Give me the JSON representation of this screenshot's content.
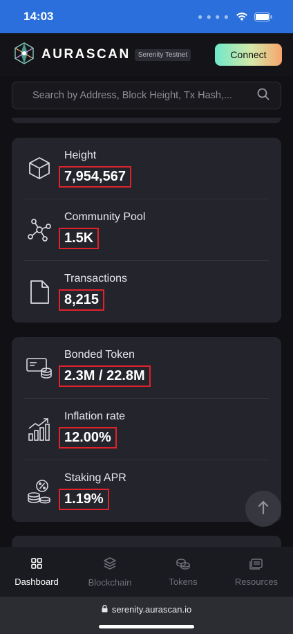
{
  "status_bar": {
    "time": "14:03"
  },
  "header": {
    "logo_text": "AURASCAN",
    "network_badge": "Serenity Testnet",
    "connect_label": "Connect"
  },
  "search": {
    "placeholder": "Search by Address, Block Height, Tx Hash,..."
  },
  "stats_card_1": [
    {
      "label": "Height",
      "value": "7,954,567",
      "icon": "cube-icon"
    },
    {
      "label": "Community Pool",
      "value": "1.5K",
      "icon": "network-nodes-icon"
    },
    {
      "label": "Transactions",
      "value": "8,215",
      "icon": "document-icon"
    }
  ],
  "stats_card_2": [
    {
      "label": "Bonded Token",
      "value": "2.3M / 22.8M",
      "icon": "bonded-token-icon"
    },
    {
      "label": "Inflation rate",
      "value": "12.00%",
      "icon": "growth-chart-icon"
    },
    {
      "label": "Staking APR",
      "value": "1.19%",
      "icon": "coins-percent-icon"
    }
  ],
  "bottom_nav": [
    {
      "label": "Dashboard",
      "icon": "dashboard-grid-icon",
      "active": true
    },
    {
      "label": "Blockchain",
      "icon": "layers-icon",
      "active": false
    },
    {
      "label": "Tokens",
      "icon": "coins-icon",
      "active": false
    },
    {
      "label": "Resources",
      "icon": "resources-icon",
      "active": false
    }
  ],
  "browser": {
    "url": "serenity.aurascan.io"
  },
  "colors": {
    "accent_red": "#e0232b",
    "status_blue": "#2a6fdb",
    "card_bg": "#23242c"
  }
}
